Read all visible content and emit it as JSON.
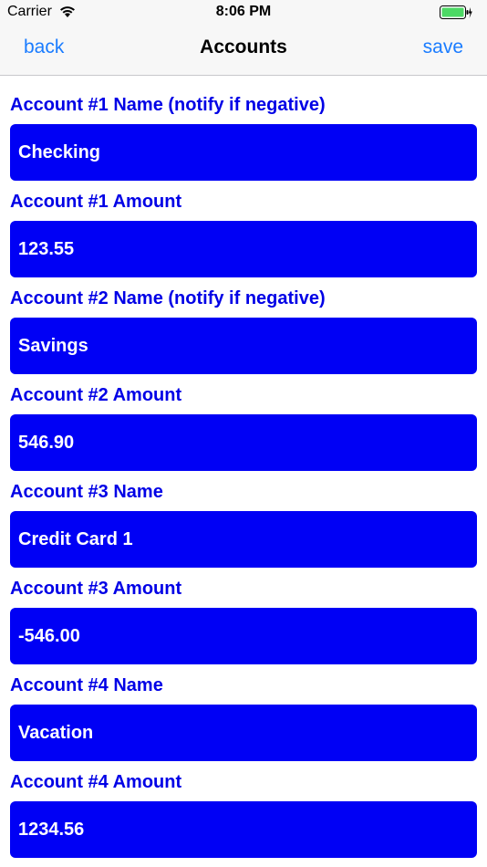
{
  "status_bar": {
    "carrier": "Carrier",
    "time": "8:06 PM",
    "battery_color": "#4cd964"
  },
  "nav": {
    "back_label": "back",
    "title": "Accounts",
    "save_label": "save",
    "accent_color": "#1a7cff"
  },
  "form": {
    "label_color": "#0000e6",
    "field_color": "#0000f5",
    "fields": [
      {
        "label": "Account #1 Name (notify if negative)",
        "value": "Checking"
      },
      {
        "label": "Account #1 Amount",
        "value": "123.55"
      },
      {
        "label": "Account #2 Name (notify if negative)",
        "value": "Savings"
      },
      {
        "label": "Account #2 Amount",
        "value": "546.90"
      },
      {
        "label": "Account #3 Name",
        "value": "Credit Card 1"
      },
      {
        "label": "Account #3 Amount",
        "value": "-546.00"
      },
      {
        "label": "Account #4 Name",
        "value": "Vacation"
      },
      {
        "label": "Account #4 Amount",
        "value": "1234.56"
      }
    ]
  }
}
